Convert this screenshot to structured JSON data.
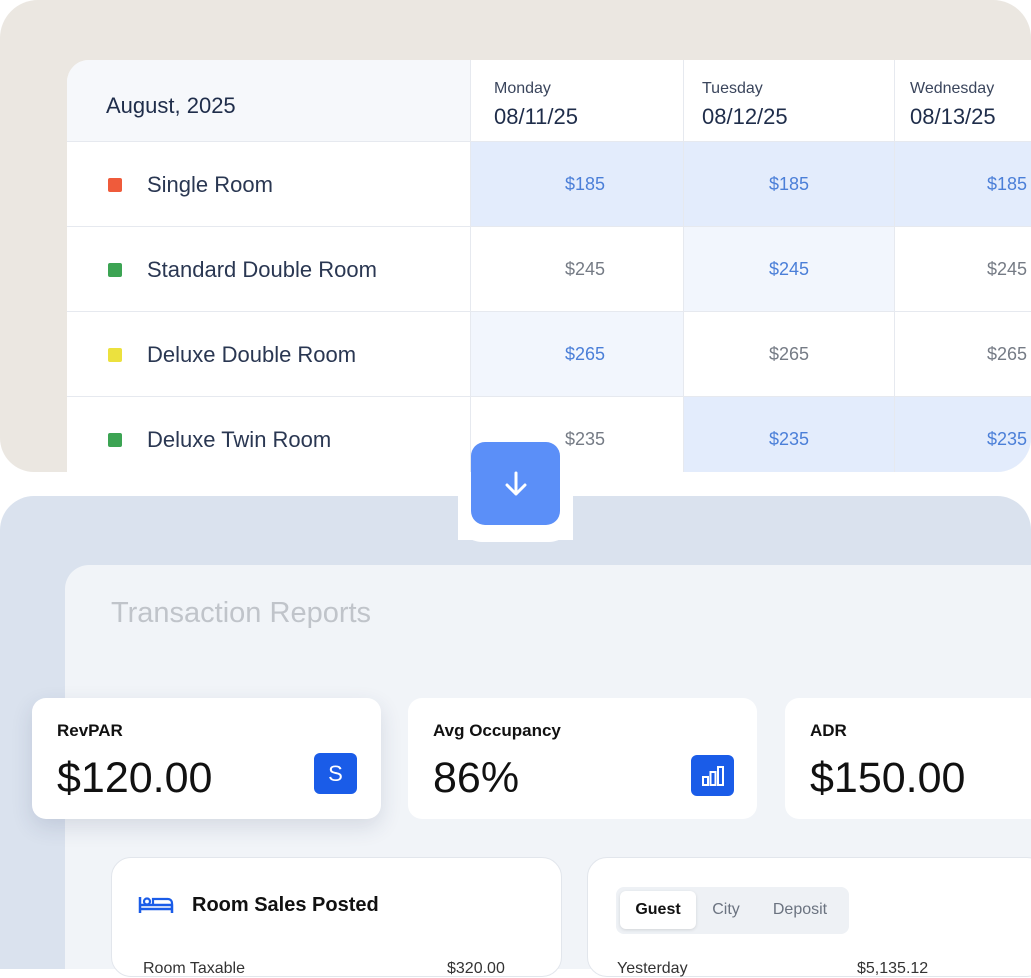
{
  "calendar": {
    "month": "August, 2025",
    "days": [
      {
        "name": "Monday",
        "date": "08/11/25"
      },
      {
        "name": "Tuesday",
        "date": "08/12/25"
      },
      {
        "name": "Wednesday",
        "date": "08/13/25"
      }
    ],
    "rooms": [
      {
        "name": "Single Room",
        "color": "#ef5b3b",
        "prices": [
          "$185",
          "$185",
          "$185"
        ]
      },
      {
        "name": "Standard Double Room",
        "color": "#3ca453",
        "prices": [
          "$245",
          "$245",
          "$245"
        ]
      },
      {
        "name": "Deluxe Double Room",
        "color": "#ece13e",
        "prices": [
          "$265",
          "$265",
          "$265"
        ]
      },
      {
        "name": "Deluxe Twin Room",
        "color": "#3ca453",
        "prices": [
          "$235",
          "$235",
          "$235"
        ]
      }
    ]
  },
  "reports": {
    "title": "Transaction Reports",
    "kpis": [
      {
        "label": "RevPAR",
        "value": "$120.00",
        "icon": "dollar-icon",
        "icon_glyph": "S"
      },
      {
        "label": "Avg Occupancy",
        "value": "86%",
        "icon": "bar-chart-icon"
      },
      {
        "label": "ADR",
        "value": "$150.00"
      }
    ],
    "room_sales": {
      "title": "Room Sales Posted",
      "icon": "bed-icon",
      "peek_label": "Room Taxable",
      "peek_value": "$320.00"
    },
    "tabs": [
      "Guest",
      "City",
      "Deposit"
    ],
    "active_tab": "Guest",
    "tab_peek_label": "Yesterday",
    "tab_peek_value": "$5,135.12"
  },
  "colors": {
    "accent": "#1a5ce8",
    "arrow_button": "#5b8ff8",
    "price_highlight": "#4b7fd8"
  }
}
